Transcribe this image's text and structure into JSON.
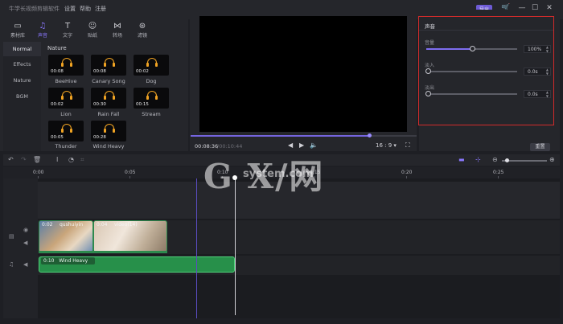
{
  "app": {
    "title": "牛学长视频剪辑软件"
  },
  "menu": {
    "items": [
      "设置",
      "帮助",
      "注册"
    ]
  },
  "export": {
    "label": "导出"
  },
  "window": {
    "cart_icon": "cart-icon",
    "minimize": "—",
    "maximize": "☐",
    "close": "✕"
  },
  "tools": [
    {
      "label": "素材库",
      "icon": "media-icon"
    },
    {
      "label": "声音",
      "icon": "music-icon"
    },
    {
      "label": "文字",
      "icon": "text-icon"
    },
    {
      "label": "贴纸",
      "icon": "sticker-icon"
    },
    {
      "label": "转场",
      "icon": "transition-icon"
    },
    {
      "label": "滤镜",
      "icon": "filter-icon"
    }
  ],
  "categories": [
    "Normal",
    "Effects",
    "Nature",
    "BGM"
  ],
  "section": {
    "title": "Nature"
  },
  "sounds": [
    {
      "name": "BeeHive",
      "duration": "00:08"
    },
    {
      "name": "Canary Song",
      "duration": "00:08"
    },
    {
      "name": "Dog",
      "duration": "00:02"
    },
    {
      "name": "Lion",
      "duration": "00:02"
    },
    {
      "name": "Rain Fall",
      "duration": "00:30"
    },
    {
      "name": "Stream",
      "duration": "00:15"
    },
    {
      "name": "Thunder",
      "duration": "00:05"
    },
    {
      "name": "Wind Heavy",
      "duration": "00:28"
    }
  ],
  "player": {
    "current": "00:08:36",
    "total": "00:10:44",
    "ratio": "16 : 9",
    "progress": 0.79
  },
  "panel": {
    "title": "声音",
    "volume": {
      "label": "音量",
      "value": "100%",
      "level": 0.5
    },
    "fade_in": {
      "label": "淡入",
      "value": "0.0s",
      "level": 0
    },
    "fade_out": {
      "label": "淡出",
      "value": "0.0s",
      "level": 0
    },
    "reset": "重置"
  },
  "ruler": {
    "labels": [
      "0:00",
      "0:05",
      "0:10",
      "0:15",
      "0:20",
      "0:25"
    ]
  },
  "clips": {
    "video": [
      {
        "time": "0:02",
        "name": "qushuiyin"
      },
      {
        "time": "0:04",
        "name": "video(14)"
      }
    ],
    "audio": {
      "time": "0:10",
      "name": "Wind Heavy"
    }
  },
  "watermark": {
    "main": "G X/网",
    "sub": "system.com"
  }
}
